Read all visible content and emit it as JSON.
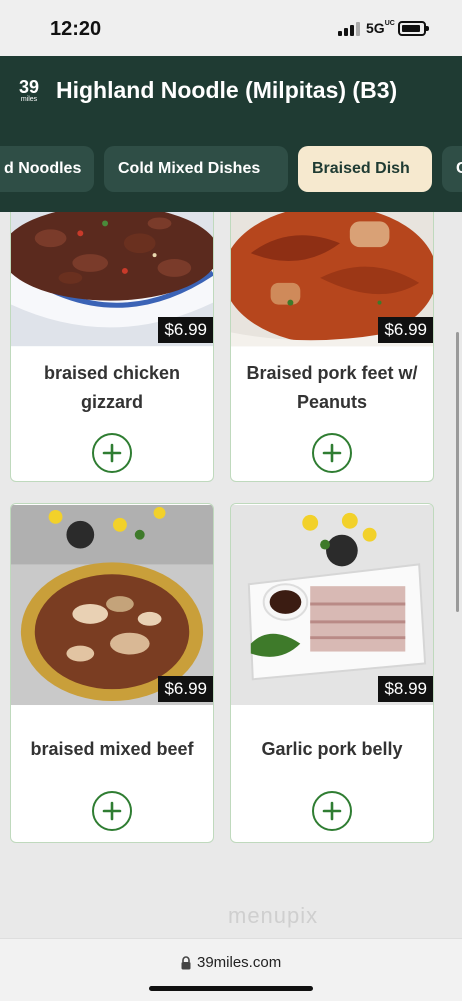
{
  "status_bar": {
    "time": "12:20",
    "network": "5G",
    "network_suffix": "UC"
  },
  "header": {
    "logo_number": "39",
    "logo_sub": "miles",
    "title": "Highland Noodle (Milpitas) (B3)"
  },
  "tabs": [
    {
      "label": "d Noodles",
      "active": false
    },
    {
      "label": "Cold Mixed Dishes",
      "active": false
    },
    {
      "label": "Braised Dish",
      "active": true
    },
    {
      "label": "C",
      "active": false
    }
  ],
  "menu_items": [
    {
      "name": "braised chicken gizzard",
      "price": "$6.99"
    },
    {
      "name": "Braised pork feet  w/ Peanuts",
      "price": "$6.99"
    },
    {
      "name": "braised mixed beef",
      "price": "$6.99"
    },
    {
      "name": "Garlic pork belly",
      "price": "$8.99"
    }
  ],
  "watermark": "menupix",
  "url_bar": {
    "url": "39miles.com"
  },
  "colors": {
    "header_bg": "#1f3b33",
    "active_tab_bg": "#f6e9cf",
    "accent_green": "#2f7d32"
  }
}
